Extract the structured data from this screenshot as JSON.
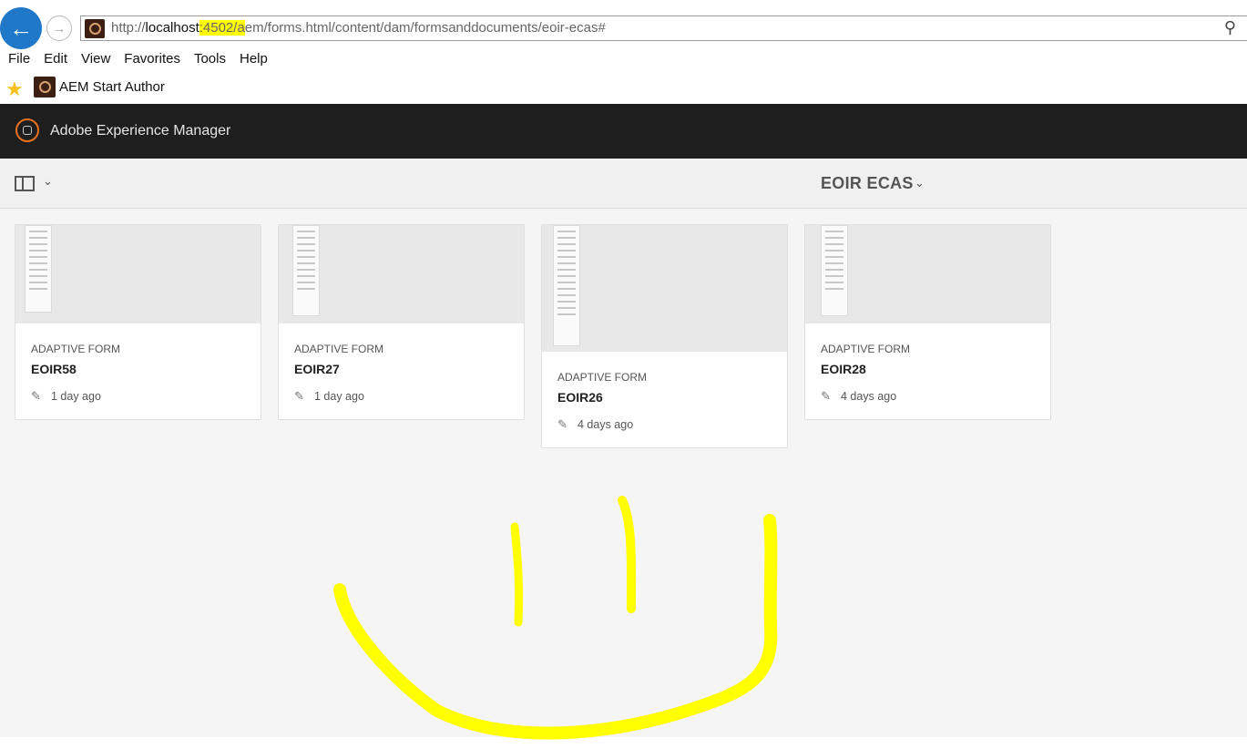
{
  "browser": {
    "url_prefix": "http://",
    "url_host": "localhost",
    "url_port": ":4502/",
    "url_a": "a",
    "url_rest": "em/forms.html/content/dam/formsanddocuments/eoir-ecas#",
    "menu": [
      "File",
      "Edit",
      "View",
      "Favorites",
      "Tools",
      "Help"
    ],
    "favorite_label": "AEM Start Author"
  },
  "header": {
    "title": "Adobe Experience Manager"
  },
  "toolbar": {
    "folder_title": "EOIR ECAS"
  },
  "cards": [
    {
      "type": "ADAPTIVE FORM",
      "name": "EOIR58",
      "modified": "1 day ago"
    },
    {
      "type": "ADAPTIVE FORM",
      "name": "EOIR27",
      "modified": "1 day ago"
    },
    {
      "type": "ADAPTIVE FORM",
      "name": "EOIR26",
      "modified": "4 days ago"
    },
    {
      "type": "ADAPTIVE FORM",
      "name": "EOIR28",
      "modified": "4 days ago"
    }
  ],
  "annotation_color": "#ffff00",
  "accent_color": "#e8711f"
}
